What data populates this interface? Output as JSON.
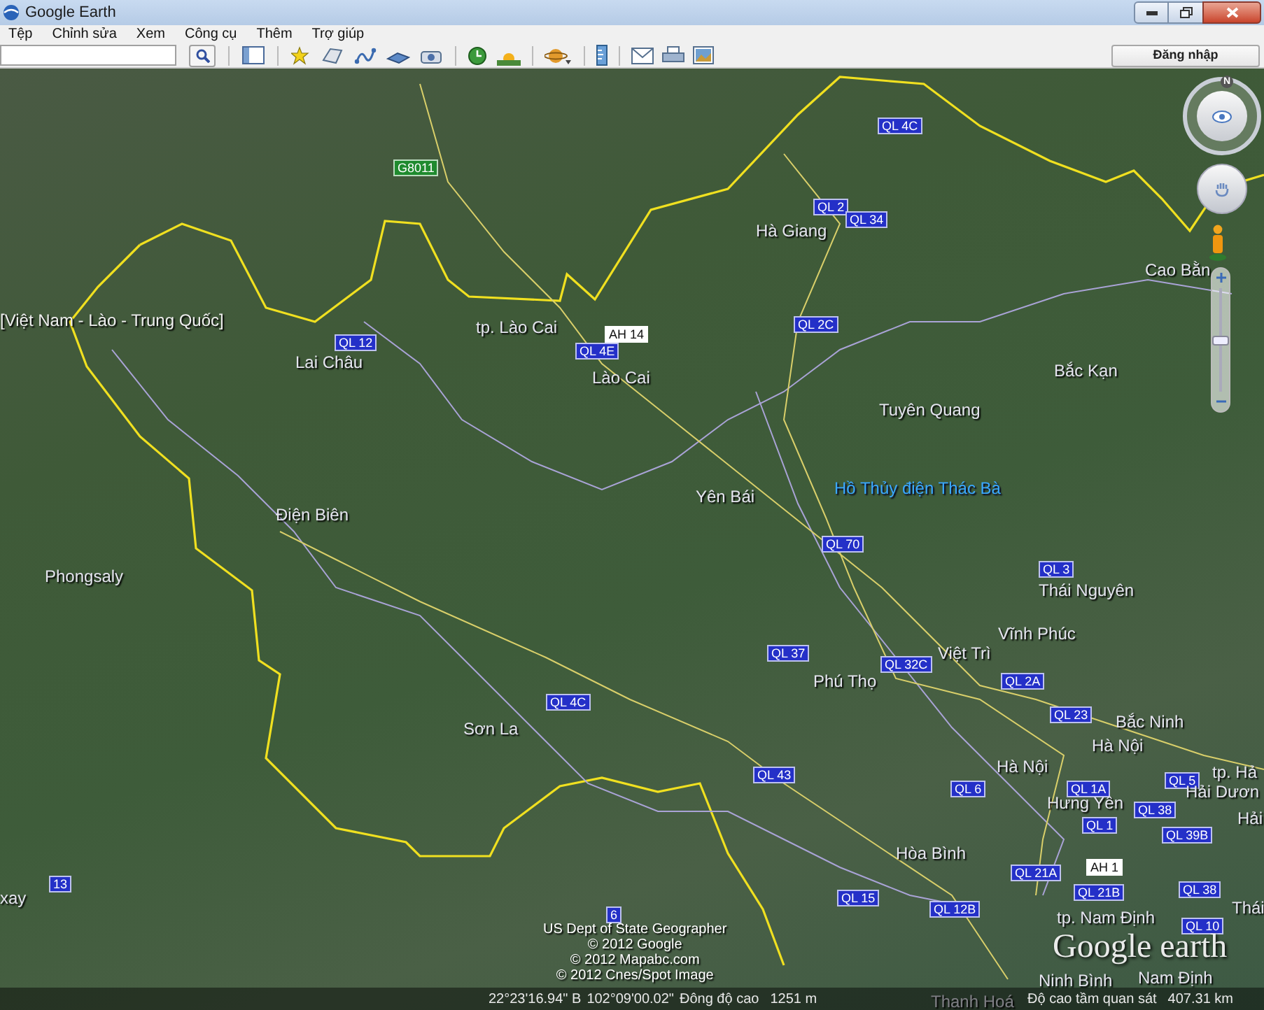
{
  "window": {
    "title": "Google Earth"
  },
  "menu": [
    "Tệp",
    "Chỉnh sửa",
    "Xem",
    "Công cụ",
    "Thêm",
    "Trợ giúp"
  ],
  "toolbar": {
    "sign_in": "Đăng nhập"
  },
  "navigation": {
    "compass_label": "N",
    "zoom": {
      "level": 0.5
    }
  },
  "map": {
    "labels": [
      {
        "kind": "road",
        "text": "G8011",
        "color": "#1f8a2e"
      },
      {
        "kind": "road",
        "text": "QL 4C",
        "color": "#2430c8"
      },
      {
        "kind": "road",
        "text": "QL 2",
        "color": "#2430c8"
      },
      {
        "kind": "road",
        "text": "QL 34",
        "color": "#2430c8"
      },
      {
        "kind": "place",
        "text": "Hà Giang"
      },
      {
        "kind": "place",
        "text": "Cao Bằn"
      },
      {
        "kind": "region",
        "text": "[Việt Nam - Lào - Trung Quốc]"
      },
      {
        "kind": "place",
        "text": "tp. Lào Cai"
      },
      {
        "kind": "road",
        "text": "AH 14",
        "color": "#ffffff"
      },
      {
        "kind": "road",
        "text": "QL 2C",
        "color": "#2430c8"
      },
      {
        "kind": "road",
        "text": "QL 12",
        "color": "#2430c8"
      },
      {
        "kind": "road",
        "text": "QL 4E",
        "color": "#2430c8"
      },
      {
        "kind": "place",
        "text": "Lai Châu"
      },
      {
        "kind": "place",
        "text": "Lào Cai"
      },
      {
        "kind": "place",
        "text": "Bắc Kạn"
      },
      {
        "kind": "place",
        "text": "Tuyên Quang"
      },
      {
        "kind": "water",
        "text": "Hồ Thủy điện Thác Bà"
      },
      {
        "kind": "place",
        "text": "Yên Bái"
      },
      {
        "kind": "place",
        "text": "Điện Biên"
      },
      {
        "kind": "road",
        "text": "QL 70",
        "color": "#2430c8"
      },
      {
        "kind": "place",
        "text": "Phongsaly"
      },
      {
        "kind": "road",
        "text": "QL 3",
        "color": "#2430c8"
      },
      {
        "kind": "place",
        "text": "Thái Nguyên"
      },
      {
        "kind": "place",
        "text": "Vĩnh Phúc"
      },
      {
        "kind": "place",
        "text": "Việt Trì"
      },
      {
        "kind": "road",
        "text": "QL 37",
        "color": "#2430c8"
      },
      {
        "kind": "road",
        "text": "QL 32C",
        "color": "#2430c8"
      },
      {
        "kind": "place",
        "text": "Phú Thọ"
      },
      {
        "kind": "road",
        "text": "QL 2A",
        "color": "#2430c8"
      },
      {
        "kind": "road",
        "text": "QL 23",
        "color": "#2430c8"
      },
      {
        "kind": "road",
        "text": "QL 4C",
        "color": "#2430c8"
      },
      {
        "kind": "place",
        "text": "Bắc Ninh"
      },
      {
        "kind": "place",
        "text": "Sơn La"
      },
      {
        "kind": "place",
        "text": "Hà Nội"
      },
      {
        "kind": "road",
        "text": "QL 43",
        "color": "#2430c8"
      },
      {
        "kind": "place",
        "text": "Hà Nội"
      },
      {
        "kind": "place",
        "text": "tp. Hả"
      },
      {
        "kind": "road",
        "text": "QL 5",
        "color": "#2430c8"
      },
      {
        "kind": "road",
        "text": "QL 6",
        "color": "#2430c8"
      },
      {
        "kind": "road",
        "text": "QL 1A",
        "color": "#2430c8"
      },
      {
        "kind": "place",
        "text": "Hải Dươn"
      },
      {
        "kind": "place",
        "text": "Hưng Yên"
      },
      {
        "kind": "road",
        "text": "QL 38",
        "color": "#2430c8"
      },
      {
        "kind": "road",
        "text": "QL 1",
        "color": "#2430c8"
      },
      {
        "kind": "place",
        "text": "Hải"
      },
      {
        "kind": "road",
        "text": "QL 39B",
        "color": "#2430c8"
      },
      {
        "kind": "place",
        "text": "Hòa Bình"
      },
      {
        "kind": "road",
        "text": "AH 1",
        "color": "#ffffff"
      },
      {
        "kind": "road",
        "text": "QL 21A",
        "color": "#2430c8"
      },
      {
        "kind": "road",
        "text": "13",
        "color": "#2430c8"
      },
      {
        "kind": "place",
        "text": "xay"
      },
      {
        "kind": "road",
        "text": "QL 21B",
        "color": "#2430c8"
      },
      {
        "kind": "road",
        "text": "QL 38",
        "color": "#2430c8"
      },
      {
        "kind": "road",
        "text": "QL 15",
        "color": "#2430c8"
      },
      {
        "kind": "road",
        "text": "QL 12B",
        "color": "#2430c8"
      },
      {
        "kind": "place",
        "text": "Thái"
      },
      {
        "kind": "road",
        "text": "QL 10",
        "color": "#2430c8"
      },
      {
        "kind": "road",
        "text": "6",
        "color": "#2430c8"
      },
      {
        "kind": "place",
        "text": "tp. Nam Định"
      },
      {
        "kind": "place",
        "text": "Nam Định"
      },
      {
        "kind": "place",
        "text": "Ninh Bình"
      },
      {
        "kind": "place",
        "text": "Thanh Hoá"
      }
    ],
    "attribution": [
      "US Dept of State Geographer",
      "© 2012 Google",
      "© 2012 Mapabc.com",
      "© 2012 Cnes/Spot Image"
    ],
    "logo": "Google earth"
  },
  "status_bar": {
    "latitude": "22°23'16.94\" B",
    "longitude": "102°09'00.02\"",
    "elevation_label": "Đông độ cao",
    "elevation": "1251 m",
    "eye_label": "Độ cao tầm quan sát",
    "eye_altitude": "407.31 km"
  }
}
